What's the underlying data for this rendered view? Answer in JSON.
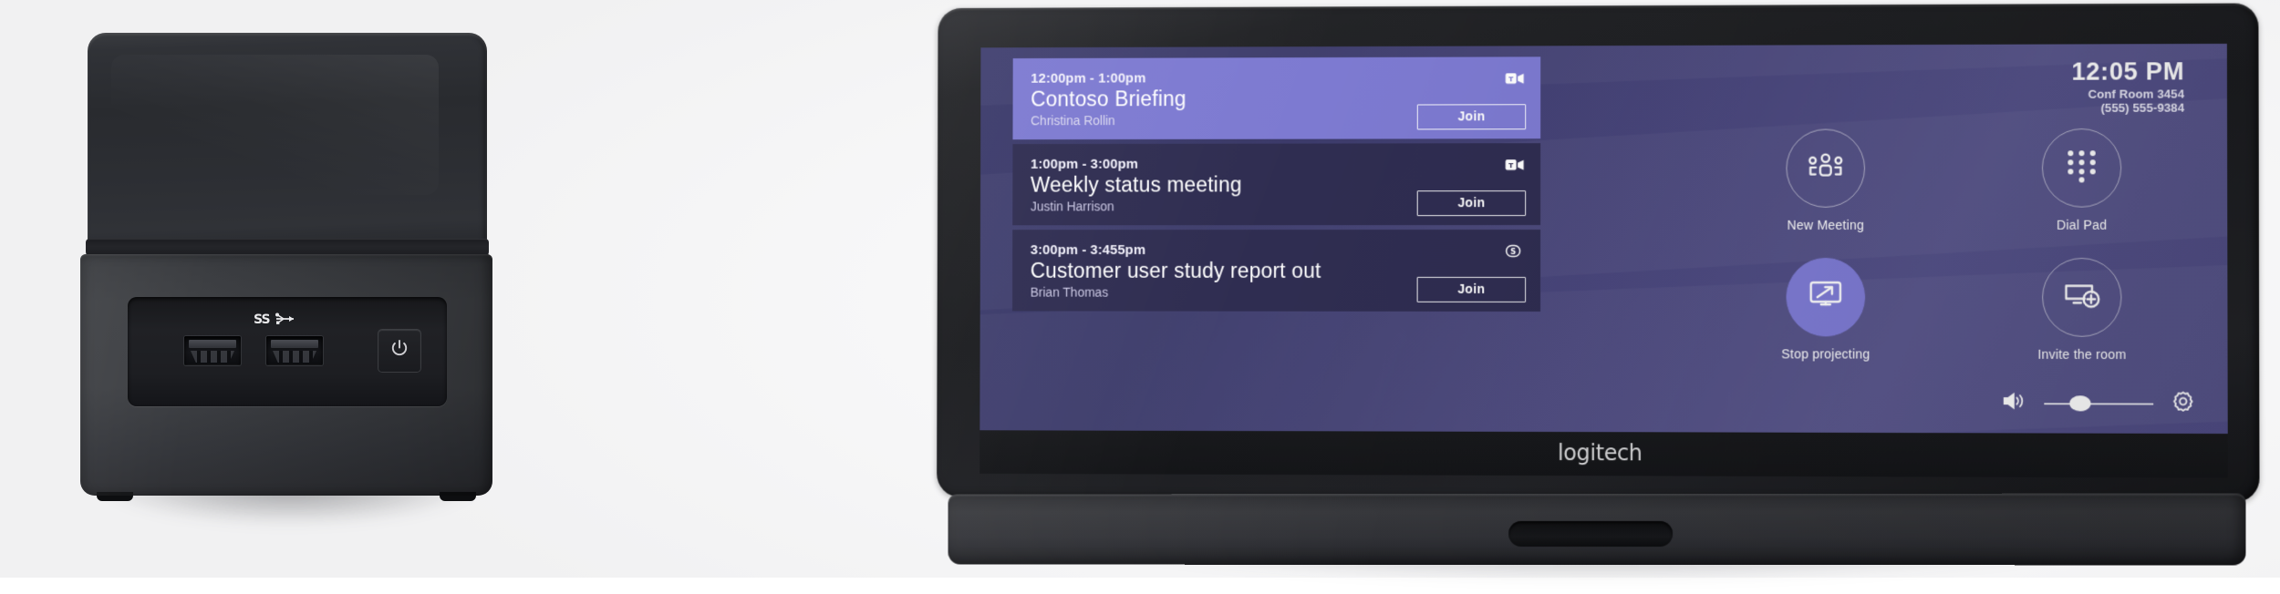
{
  "scene": {
    "left_device": {
      "name": "mini-pc",
      "usb_logo": "SS",
      "ports": [
        "usb-3-port",
        "usb-3-port"
      ],
      "power_button": "power-icon"
    },
    "right_device": {
      "name": "logitech-tap-touch-console",
      "brand": "logitech"
    }
  },
  "screen": {
    "agenda": {
      "meetings": [
        {
          "time": "12:00pm - 1:00pm",
          "title": "Contoso Briefing",
          "organizer": "Christina Rollin",
          "join_label": "Join",
          "provider_icon": "teams-meeting-icon",
          "state": "active"
        },
        {
          "time": "1:00pm - 3:00pm",
          "title": "Weekly status meeting",
          "organizer": "Justin Harrison",
          "join_label": "Join",
          "provider_icon": "teams-meeting-icon",
          "state": "idle"
        },
        {
          "time": "3:00pm - 3:455pm",
          "title": "Customer user study report out",
          "organizer": "Brian Thomas",
          "join_label": "Join",
          "provider_icon": "skype-meeting-icon",
          "state": "idle"
        }
      ]
    },
    "status": {
      "time": "12:05 PM",
      "room": "Conf Room 3454",
      "phone": "(555) 555-9384"
    },
    "actions": [
      {
        "label": "New Meeting",
        "icon": "people-group-icon",
        "active": false
      },
      {
        "label": "Dial Pad",
        "icon": "dial-pad-icon",
        "active": false
      },
      {
        "label": "Stop projecting",
        "icon": "screen-share-icon",
        "active": true
      },
      {
        "label": "Invite the room",
        "icon": "add-screen-icon",
        "active": false
      }
    ],
    "controls": {
      "volume_icon": "volume-up-icon",
      "volume_percent": 33,
      "settings_icon": "gear-icon"
    },
    "colors": {
      "accent": "#7d7ad1",
      "card_idle": "#2f2d51",
      "bg_start": "#3b3a6b",
      "bg_end": "#4f4c84"
    }
  }
}
